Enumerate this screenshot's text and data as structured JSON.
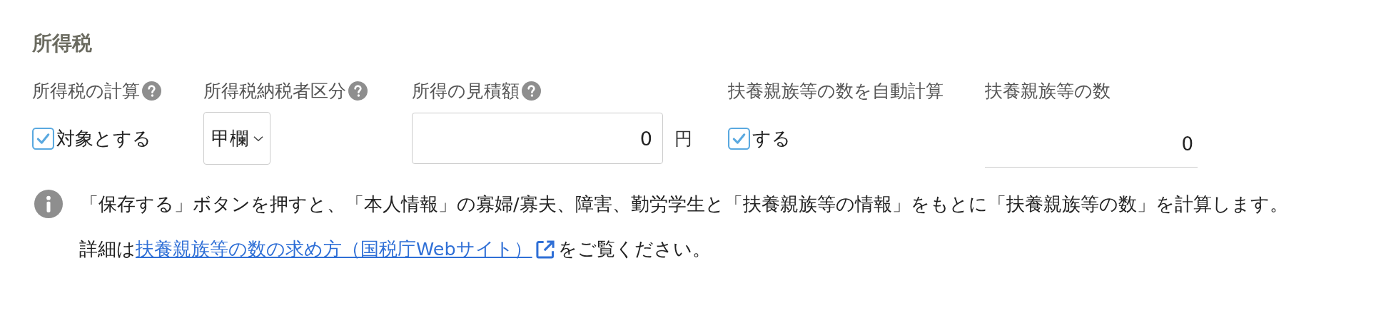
{
  "section_title": "所得税",
  "fields": [
    {
      "kind": "checkbox",
      "label": "所得税の計算",
      "help": true,
      "checked": true,
      "option": "対象とする"
    },
    {
      "kind": "select",
      "label": "所得税納税者区分",
      "help": true,
      "value": "甲欄"
    },
    {
      "kind": "amount",
      "label": "所得の見積額",
      "help": true,
      "value": "0",
      "unit": "円"
    },
    {
      "kind": "checkbox",
      "label": "扶養親族等の数を自動計算",
      "help": false,
      "checked": true,
      "option": "する"
    },
    {
      "kind": "readonly",
      "label": "扶養親族等の数",
      "help": false,
      "value": "0"
    }
  ],
  "notice": {
    "text": "「保存する」ボタンを押すと、「本人情報」の寡婦/寡夫、障害、勤労学生と「扶養親族等の情報」をもとに「扶養親族等の数」を計算します。",
    "detail_prefix": "詳細は",
    "link": "扶養親族等の数の求め方（国税庁Webサイト）",
    "detail_suffix": "をご覧ください。"
  }
}
